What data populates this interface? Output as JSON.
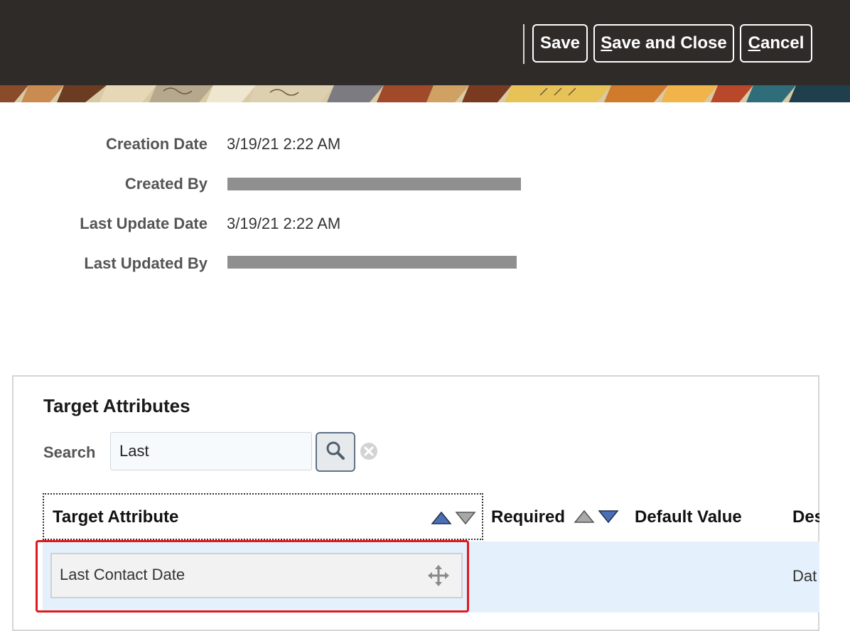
{
  "toolbar": {
    "save": "Save",
    "save_and_close_first": "S",
    "save_and_close_rest": "ave and Close",
    "cancel_first": "C",
    "cancel_rest": "ancel"
  },
  "info": {
    "creation_date_label": "Creation Date",
    "creation_date_value": "3/19/21 2:22 AM",
    "created_by_label": "Created By",
    "last_update_date_label": "Last Update Date",
    "last_update_date_value": "3/19/21 2:22 AM",
    "last_updated_by_label": "Last Updated By"
  },
  "panel": {
    "title": "Target Attributes",
    "search_label": "Search",
    "search_value": "Last"
  },
  "table": {
    "headers": [
      "Target Attribute",
      "Required",
      "Default Value",
      "Des"
    ],
    "rows": [
      {
        "target_attribute": "Last Contact Date",
        "description": "Dat"
      }
    ]
  },
  "colors": {
    "header_bg": "#2f2b28",
    "row_selected_bg": "#e4f0fb",
    "highlight_border": "#e0191b",
    "sort_active": "#4a6fb5"
  }
}
